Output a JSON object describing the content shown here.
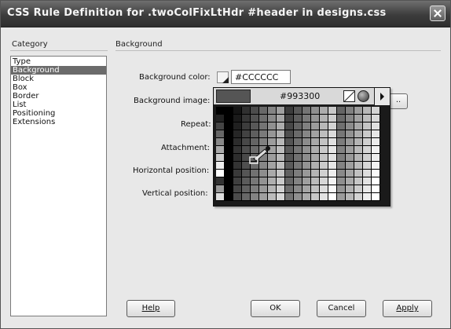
{
  "window": {
    "title": "CSS Rule Definition for .twoColFixLtHdr #header in designs.css"
  },
  "category_panel": {
    "header": "Category",
    "items": [
      "Type",
      "Background",
      "Block",
      "Box",
      "Border",
      "List",
      "Positioning",
      "Extensions"
    ],
    "selected": "Background"
  },
  "background_panel": {
    "header": "Background",
    "color_label": "Background color:",
    "color_value": "#CCCCCC",
    "image_label": "Background image:",
    "repeat_label": "Repeat:",
    "attachment_label": "Attachment:",
    "hpos_label": "Horizontal position:",
    "vpos_label": "Vertical position:",
    "browse_label": ".."
  },
  "color_picker": {
    "hex": "#993300",
    "preview_color": "#555555",
    "icons": [
      "no-color-icon",
      "system-color-picker-icon",
      "palette-menu-arrow-icon"
    ]
  },
  "buttons": {
    "help": "Help",
    "ok": "OK",
    "cancel": "Cancel",
    "apply": "Apply"
  }
}
